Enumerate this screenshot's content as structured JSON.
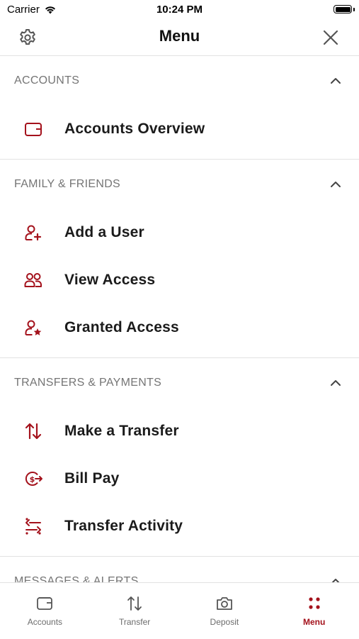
{
  "status_bar": {
    "carrier": "Carrier",
    "time": "10:24 PM"
  },
  "header": {
    "title": "Menu",
    "settings_icon": "gear-icon",
    "close_icon": "close-icon"
  },
  "colors": {
    "accent": "#a4121c",
    "section_text": "#757575",
    "divider": "#e2e2e2"
  },
  "sections": [
    {
      "title": "ACCOUNTS",
      "items": [
        {
          "label": "Accounts Overview",
          "icon": "wallet-icon"
        }
      ]
    },
    {
      "title": "FAMILY & FRIENDS",
      "items": [
        {
          "label": "Add a User",
          "icon": "user-add-icon"
        },
        {
          "label": "View Access",
          "icon": "users-icon"
        },
        {
          "label": "Granted Access",
          "icon": "user-star-icon"
        }
      ]
    },
    {
      "title": "TRANSFERS & PAYMENTS",
      "items": [
        {
          "label": "Make a Transfer",
          "icon": "transfer-icon"
        },
        {
          "label": "Bill Pay",
          "icon": "bill-pay-icon"
        },
        {
          "label": "Transfer Activity",
          "icon": "transfer-activity-icon"
        }
      ]
    },
    {
      "title": "MESSAGES & ALERTS",
      "items": []
    }
  ],
  "tabs": [
    {
      "label": "Accounts",
      "icon": "wallet-icon",
      "active": false
    },
    {
      "label": "Transfer",
      "icon": "transfer-icon",
      "active": false
    },
    {
      "label": "Deposit",
      "icon": "camera-icon",
      "active": false
    },
    {
      "label": "Menu",
      "icon": "menu-dots-icon",
      "active": true
    }
  ]
}
